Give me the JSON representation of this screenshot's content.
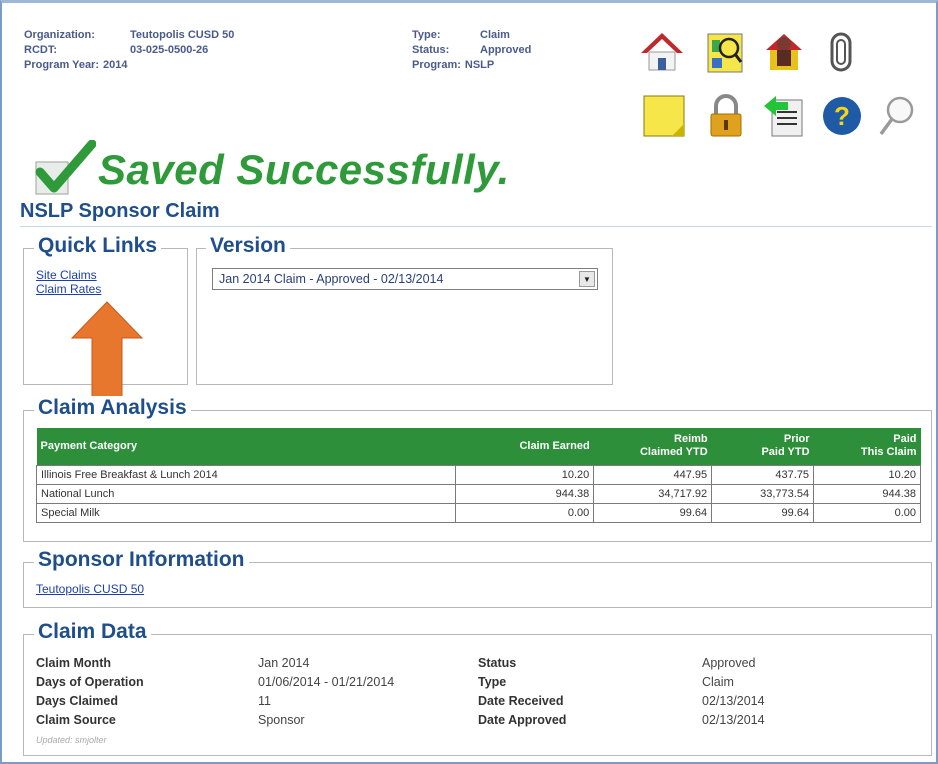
{
  "header": {
    "organization_label": "Organization:",
    "organization": "Teutopolis CUSD 50",
    "rcdt_label": "RCDT:",
    "rcdt": "03-025-0500-26",
    "program_year_label": "Program Year:",
    "program_year": "2014",
    "type_label": "Type:",
    "type": "Claim",
    "status_label": "Status:",
    "status": "Approved",
    "program_label": "Program:",
    "program": "NSLP"
  },
  "toolbar_icons": [
    "home-icon",
    "search-person-icon",
    "user-admin-icon",
    "attachment-icon",
    "notes-icon",
    "lock-icon",
    "export-icon",
    "help-icon",
    "search-icon"
  ],
  "message": {
    "saved": "Saved Successfully."
  },
  "page_title": "NSLP Sponsor Claim",
  "quick_links": {
    "legend": "Quick Links",
    "items": [
      "Site Claims",
      "Claim Rates"
    ]
  },
  "version": {
    "legend": "Version",
    "selected": "Jan 2014 Claim - Approved - 02/13/2014"
  },
  "claim_analysis": {
    "legend": "Claim Analysis",
    "headers": {
      "category": "Payment Category",
      "earned": "Claim Earned",
      "reimb_1": "Reimb",
      "reimb_2": "Claimed YTD",
      "prior_1": "Prior",
      "prior_2": "Paid YTD",
      "paid_1": "Paid",
      "paid_2": "This Claim"
    },
    "rows": [
      {
        "category": "Illinois Free Breakfast & Lunch 2014",
        "earned": "10.20",
        "reimb": "447.95",
        "prior": "437.75",
        "paid": "10.20"
      },
      {
        "category": "National Lunch",
        "earned": "944.38",
        "reimb": "34,717.92",
        "prior": "33,773.54",
        "paid": "944.38"
      },
      {
        "category": "Special Milk",
        "earned": "0.00",
        "reimb": "99.64",
        "prior": "99.64",
        "paid": "0.00"
      }
    ]
  },
  "sponsor_info": {
    "legend": "Sponsor Information",
    "link": "Teutopolis CUSD 50"
  },
  "claim_data": {
    "legend": "Claim Data",
    "claim_month_label": "Claim Month",
    "claim_month": "Jan 2014",
    "days_operation_label": "Days of Operation",
    "days_operation": "01/06/2014 - 01/21/2014",
    "days_claimed_label": "Days Claimed",
    "days_claimed": "11",
    "claim_source_label": "Claim Source",
    "claim_source": "Sponsor",
    "status_label": "Status",
    "status": "Approved",
    "type_label": "Type",
    "type": "Claim",
    "date_received_label": "Date Received",
    "date_received": "02/13/2014",
    "date_approved_label": "Date Approved",
    "date_approved": "02/13/2014",
    "updated": "Updated: smjolter"
  },
  "colors": {
    "accent_green": "#2e9a3a",
    "table_header": "#2d8f39",
    "title_blue": "#1f4e8c",
    "arrow_orange": "#e8772e"
  }
}
